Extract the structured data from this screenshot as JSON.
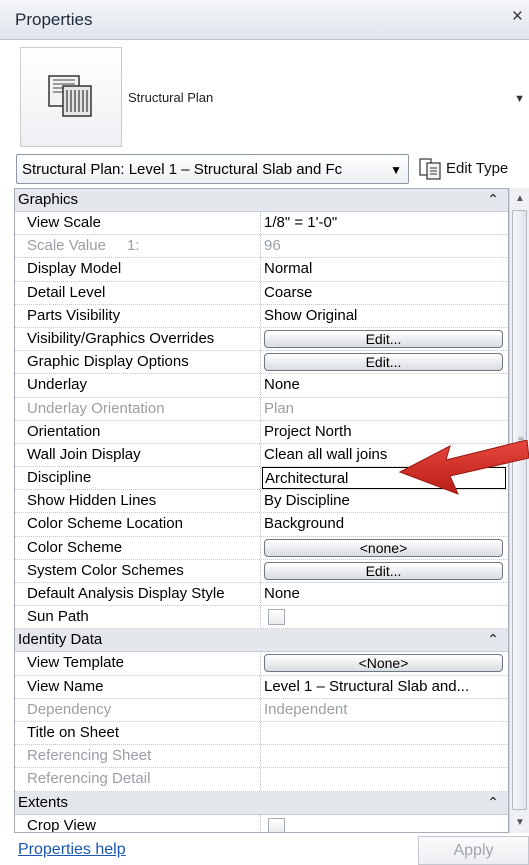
{
  "window": {
    "title": "Properties",
    "close_glyph": "×"
  },
  "preview": {
    "type_name": "Structural Plan",
    "icon": "structural-plan-icon"
  },
  "type_selector": {
    "value": "Structural Plan: Level 1 – Structural Slab and Fc",
    "arrow": "▼"
  },
  "edit_type": {
    "label": "Edit Type",
    "icon": "edit-type-icon"
  },
  "groups": [
    {
      "name": "Graphics",
      "collapse_glyph": "⌃",
      "rows": [
        {
          "name": "View Scale",
          "value": "1/8\" = 1'-0\"",
          "kind": "text"
        },
        {
          "name": "Scale Value",
          "name_suffix": "1:",
          "value": "96",
          "kind": "text",
          "disabled": true
        },
        {
          "name": "Display Model",
          "value": "Normal",
          "kind": "text"
        },
        {
          "name": "Detail Level",
          "value": "Coarse",
          "kind": "text"
        },
        {
          "name": "Parts Visibility",
          "value": "Show Original",
          "kind": "text"
        },
        {
          "name": "Visibility/Graphics Overrides",
          "value": "Edit...",
          "kind": "button"
        },
        {
          "name": "Graphic Display Options",
          "value": "Edit...",
          "kind": "button"
        },
        {
          "name": "Underlay",
          "value": "None",
          "kind": "text"
        },
        {
          "name": "Underlay Orientation",
          "value": "Plan",
          "kind": "text",
          "disabled": true
        },
        {
          "name": "Orientation",
          "value": "Project North",
          "kind": "text"
        },
        {
          "name": "Wall Join Display",
          "value": "Clean all wall joins",
          "kind": "text"
        },
        {
          "name": "Discipline",
          "value": "Architectural",
          "kind": "input"
        },
        {
          "name": "Show Hidden Lines",
          "value": "By Discipline",
          "kind": "text"
        },
        {
          "name": "Color Scheme Location",
          "value": "Background",
          "kind": "text"
        },
        {
          "name": "Color Scheme",
          "value": "<none>",
          "kind": "button"
        },
        {
          "name": "System Color Schemes",
          "value": "Edit...",
          "kind": "button"
        },
        {
          "name": "Default Analysis Display Style",
          "value": "None",
          "kind": "text"
        },
        {
          "name": "Sun Path",
          "value": "",
          "kind": "checkbox"
        }
      ]
    },
    {
      "name": "Identity Data",
      "collapse_glyph": "⌃",
      "rows": [
        {
          "name": "View Template",
          "value": "<None>",
          "kind": "button"
        },
        {
          "name": "View Name",
          "value": "Level 1 – Structural Slab and...",
          "kind": "text"
        },
        {
          "name": "Dependency",
          "value": "Independent",
          "kind": "text",
          "disabled": true
        },
        {
          "name": "Title on Sheet",
          "value": "",
          "kind": "text"
        },
        {
          "name": "Referencing Sheet",
          "value": "",
          "kind": "text",
          "disabled": true
        },
        {
          "name": "Referencing Detail",
          "value": "",
          "kind": "text",
          "disabled": true
        }
      ]
    },
    {
      "name": "Extents",
      "collapse_glyph": "⌃",
      "rows": [
        {
          "name": "Crop View",
          "value": "",
          "kind": "checkbox"
        }
      ]
    }
  ],
  "footer": {
    "help_link": "Properties help",
    "apply_label": "Apply"
  },
  "colors": {
    "annotation_arrow": "#d42a22",
    "link": "#1a57b3",
    "group_bg": "#e4e7eb"
  }
}
